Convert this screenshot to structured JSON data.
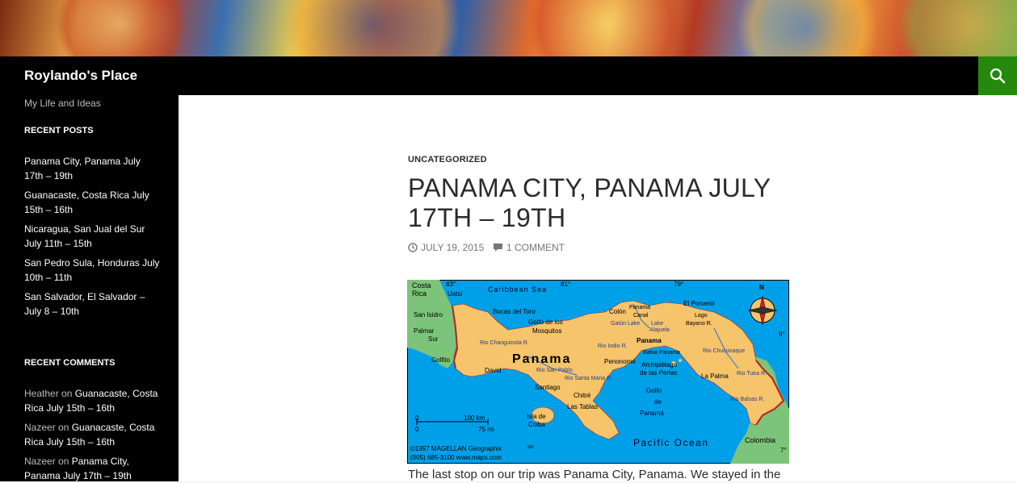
{
  "site": {
    "title": "Roylando's Place",
    "tagline": "My Life and Ideas"
  },
  "icons": {
    "search": "search-icon",
    "clock": "clock-icon",
    "comment": "comment-icon",
    "compass": "compass-rose-icon"
  },
  "colors": {
    "search_bg": "#24890d",
    "sidebar_bg": "#000000",
    "map_sea": "#00a0e8",
    "map_land": "#f5c46b",
    "map_border": "#b22222"
  },
  "sidebar": {
    "recent_posts_title": "RECENT POSTS",
    "recent_posts": [
      {
        "line1": "Panama City, Panama July",
        "line2": "17th – 19th"
      },
      {
        "line1": "Guanacaste, Costa Rica July",
        "line2": "15th – 16th"
      },
      {
        "line1": "Nicaragua, San Jual del Sur",
        "line2": "July 11th – 15th"
      },
      {
        "line1": "San Pedro Sula, Honduras July",
        "line2": "10th – 11th"
      },
      {
        "line1": "San Salvador, El Salvador –",
        "line2": "July 8 – 10th"
      }
    ],
    "recent_comments_title": "RECENT COMMENTS",
    "recent_comments": [
      {
        "author": "Heather",
        "on": " on ",
        "title1": "Guanacaste, Costa",
        "title2": "Rica July 15th – 16th"
      },
      {
        "author": "Nazeer",
        "on": " on ",
        "title1": "Guanacaste, Costa",
        "title2": "Rica July 15th – 16th"
      },
      {
        "author": "Nazeer",
        "on": " on ",
        "title1": "Panama City,",
        "title2": "Panama July 17th – 19th"
      }
    ]
  },
  "post": {
    "category": "UNCATEGORIZED",
    "title": "PANAMA CITY, PANAMA JULY 17TH – 19TH",
    "date": "JULY 19, 2015",
    "comments": "1 COMMENT",
    "body_first_line": "The last stop on our trip was Panama City, Panama. We stayed in the"
  },
  "map": {
    "country_label": "Panama",
    "labels": {
      "costa_rica": "Costa",
      "costa_rica2": "Rica",
      "caribbean": "Caribbean Sea",
      "pacific": "Pacific Ocean",
      "colombia": "Colombia",
      "gulf_mosquitos1": "Golfo de los",
      "gulf_mosquitos2": "Mosquitos",
      "golfo_panama1": "Golfo",
      "golfo_panama2": "de",
      "golfo_panama3": "Panamá",
      "bocas": "Bocas del Toro",
      "colon": "Colón",
      "panama_canal1": "Panama",
      "panama_canal2": "Canal",
      "panama_city": "Panama",
      "bahia": "Bahia Panama",
      "archipielago1": "Archipiélago",
      "archipielago2": "de las Perlas",
      "david": "David",
      "santiago": "Santiago",
      "chitre": "Chitré",
      "las_tablas": "Las Tablas",
      "isla_coiba1": "Isla de",
      "isla_coiba2": "Coiba",
      "penonome": "Penonomé",
      "la_palma": "La Palma",
      "el_porvenir": "El Porvenir",
      "golfito": "Golfito",
      "san_isidro": "San Isidro",
      "palmar": "Palmar",
      "sur": "Sur",
      "uatsi": "Uatsi",
      "rio_chucunaque": "Rio Chucunaque",
      "rio_tuira": "Rio Tuira R.",
      "rio_balsas": "Rio Balsas R.",
      "rio_indio": "Rio Indio R.",
      "rio_changuinola": "Rio Changuinola R.",
      "rio_san_pablo": "Rio San Pablo",
      "rio_santa_maria": "Rio Santa Maria R.",
      "lake_alajuela1": "Lake",
      "lake_alajuela2": "Alajuela",
      "gatun": "Gatún Lake",
      "lago_bayano1": "Lago",
      "lago_bayano2": "Bayano R.",
      "deg83": "83°",
      "deg81": "81°",
      "deg79": "79°",
      "deg9": "9°",
      "deg7": "7°",
      "north": "N",
      "scale_km": "100 km",
      "scale_mi": "75 mi",
      "scale_zero1": "0",
      "scale_zero2": "0",
      "credit1": "©1997 MAGELLAN Geographix",
      "credit_sm": "SM",
      "credit2": "(805) 685-3100  www.maps.com"
    }
  }
}
